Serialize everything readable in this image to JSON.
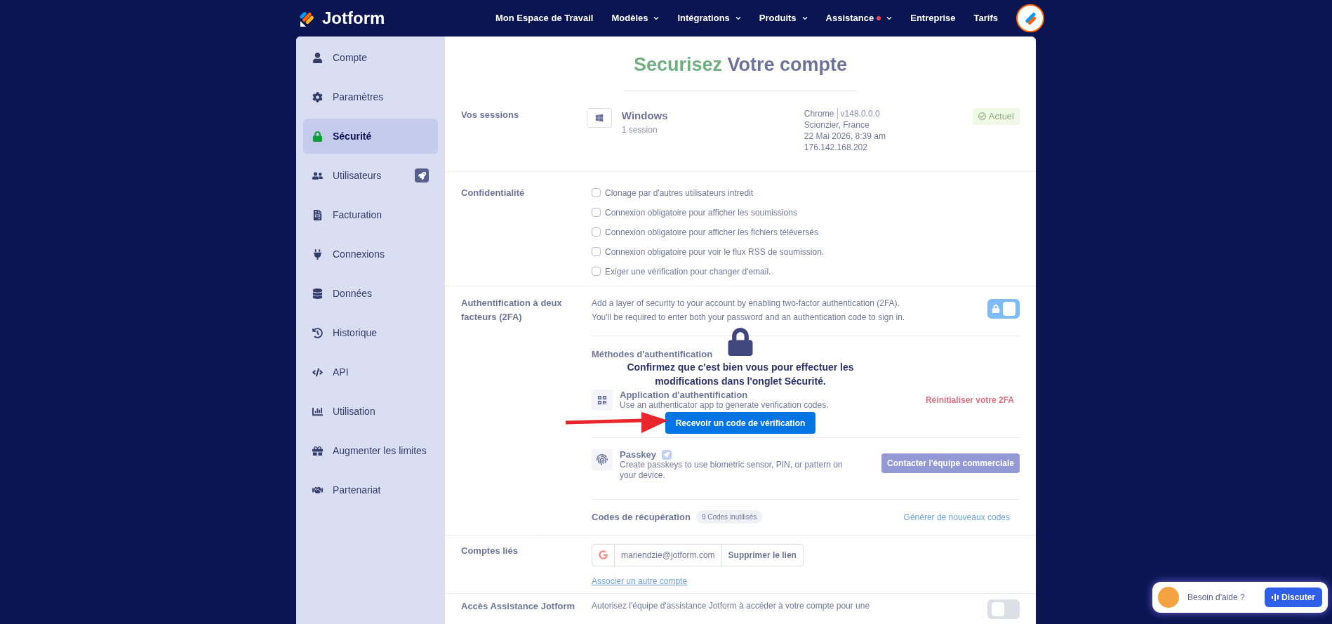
{
  "header": {
    "logo": "Jotform",
    "nav": [
      {
        "label": "Mon Espace de Travail",
        "dropdown": false,
        "notification": false
      },
      {
        "label": "Modèles",
        "dropdown": true,
        "notification": false
      },
      {
        "label": "Intégrations",
        "dropdown": true,
        "notification": false
      },
      {
        "label": "Produits",
        "dropdown": true,
        "notification": false
      },
      {
        "label": "Assistance",
        "dropdown": true,
        "notification": true
      },
      {
        "label": "Entreprise",
        "dropdown": false,
        "notification": false
      },
      {
        "label": "Tarifs",
        "dropdown": false,
        "notification": false
      }
    ]
  },
  "sidebar": {
    "items": [
      {
        "label": "Compte",
        "selected": false,
        "upgrade": false
      },
      {
        "label": "Paramètres",
        "selected": false,
        "upgrade": false
      },
      {
        "label": "Sécurité",
        "selected": true,
        "upgrade": false
      },
      {
        "label": "Utilisateurs",
        "selected": false,
        "upgrade": true
      },
      {
        "label": "Facturation",
        "selected": false,
        "upgrade": false
      },
      {
        "label": "Connexions",
        "selected": false,
        "upgrade": false
      },
      {
        "label": "Données",
        "selected": false,
        "upgrade": false
      },
      {
        "label": "Historique",
        "selected": false,
        "upgrade": false
      },
      {
        "label": "API",
        "selected": false,
        "upgrade": false
      },
      {
        "label": "Utilisation",
        "selected": false,
        "upgrade": false
      },
      {
        "label": "Augmenter les limites",
        "selected": false,
        "upgrade": false
      },
      {
        "label": "Partenariat",
        "selected": false,
        "upgrade": false
      }
    ]
  },
  "page": {
    "title_highlight": "Securisez",
    "title_rest": "Votre compte"
  },
  "sessions": {
    "label": "Vos sessions",
    "device": "Windows",
    "count": "1 session",
    "browser": "Chrome",
    "version": "v148.0.0.0",
    "location": "Scionzier, France",
    "date": "22 Mai 2026, 8:39 am",
    "ip": "176.142.168.202",
    "status": "Actuel"
  },
  "privacy": {
    "label": "Confidentialité",
    "options": [
      {
        "label": "Clonage par d'autres utilisateurs intredit",
        "checked": false
      },
      {
        "label": "Connexion obligatoire pour afficher les soumissions",
        "checked": false
      },
      {
        "label": "Connexion obligatoire pour afficher les fichiers téléversés",
        "checked": false
      },
      {
        "label": "Connexion obligatoire pour voir le flux RSS de soumission.",
        "checked": false
      },
      {
        "label": "Exiger une vérification pour changer d'email.",
        "checked": false
      }
    ]
  },
  "two_factor": {
    "label": "Authentification à deux facteurs (2FA)",
    "description": "Add a layer of security to your account by enabling two-factor authentication (2FA). You'll be required to enter both your password and an authentication code to sign in.",
    "toggle_on": true,
    "methods_title": "Méthodes d'authentification",
    "methods": [
      {
        "kind": "app",
        "name": "Application d'authentification",
        "description": "Use an authenticator app to generate verification codes.",
        "action": "Réinitialiser votre 2FA"
      },
      {
        "kind": "passkey",
        "name": "Passkey",
        "description": "Create passkeys to use biometric sensor, PIN, or pattern on your device.",
        "action": "Contacter l'équipe commerciale"
      }
    ],
    "recovery": {
      "title": "Codes de récupération",
      "badge": "9 Codes inutilisés",
      "action": "Générer de nouveaux codes"
    }
  },
  "linked": {
    "label": "Comptes liés",
    "email": "mariendzie@jotform.com",
    "remove": "Supprimer le lien",
    "link": "Associer un autre compte"
  },
  "support": {
    "label": "Accès Assistance Jotform",
    "description": "Autorisez l'équipe d'assistance Jotform à accéder à votre compte pour une",
    "toggle_on": false
  },
  "overlay": {
    "message": "Confirmez que c'est bien vous pour effectuer les modifications dans l'onglet Sécurité.",
    "button": "Recevoir un code de vérification"
  },
  "chat": {
    "prompt": "Besoin d'aide ?",
    "button": "Discuter"
  }
}
